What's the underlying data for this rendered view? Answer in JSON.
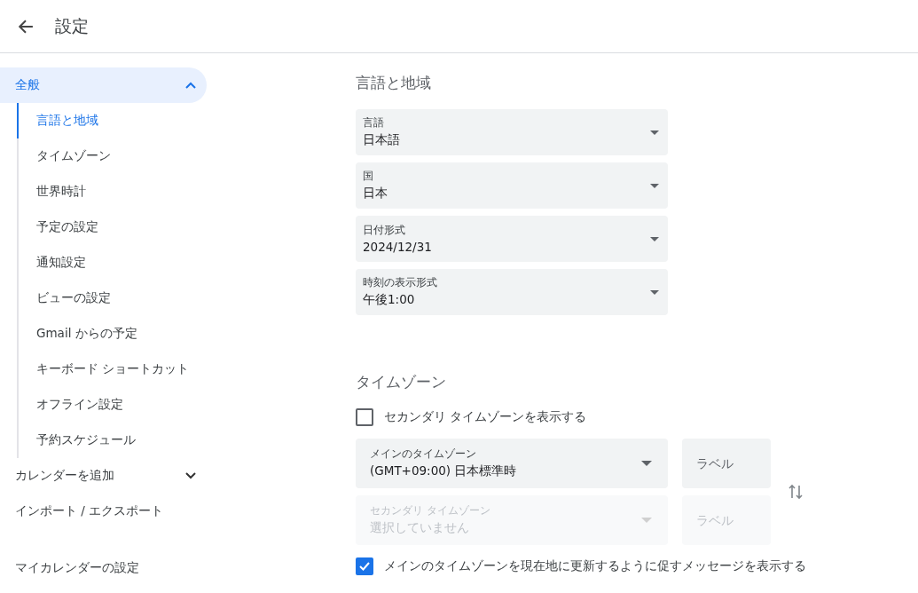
{
  "header": {
    "title": "設定"
  },
  "sidebar": {
    "items": [
      {
        "kind": "group",
        "label": "全般",
        "expanded": true,
        "children": [
          {
            "label": "言語と地域",
            "selected": true
          },
          {
            "label": "タイムゾーン",
            "selected": false
          },
          {
            "label": "世界時計",
            "selected": false
          },
          {
            "label": "予定の設定",
            "selected": false
          },
          {
            "label": "通知設定",
            "selected": false
          },
          {
            "label": "ビューの設定",
            "selected": false
          },
          {
            "label": "Gmail からの予定",
            "selected": false
          },
          {
            "label": "キーボード ショートカット",
            "selected": false
          },
          {
            "label": "オフライン設定",
            "selected": false
          },
          {
            "label": "予約スケジュール",
            "selected": false
          }
        ]
      },
      {
        "kind": "group",
        "label": "カレンダーを追加",
        "expanded": false
      },
      {
        "kind": "link",
        "label": "インポート / エクスポート"
      }
    ],
    "section_heading": "マイカレンダーの設定"
  },
  "language_region": {
    "title": "言語と地域",
    "fields": [
      {
        "label": "言語",
        "value": "日本語"
      },
      {
        "label": "国",
        "value": "日本"
      },
      {
        "label": "日付形式",
        "value": "2024/12/31"
      },
      {
        "label": "時刻の表示形式",
        "value": "午後1:00"
      }
    ]
  },
  "timezone": {
    "title": "タイムゾーン",
    "show_secondary": {
      "label": "セカンダリ タイムゾーンを表示する",
      "checked": false
    },
    "rows": [
      {
        "zone": {
          "label": "メインのタイムゾーン",
          "value": "(GMT+09:00) 日本標準時"
        },
        "label_field": {
          "placeholder": "ラベル"
        },
        "disabled": false
      },
      {
        "zone": {
          "label": "セカンダリ タイムゾーン",
          "value": "選択していません"
        },
        "label_field": {
          "placeholder": "ラベル"
        },
        "disabled": true
      }
    ],
    "prompt_update": {
      "label": "メインのタイムゾーンを現在地に更新するように促すメッセージを表示する",
      "checked": true
    }
  }
}
